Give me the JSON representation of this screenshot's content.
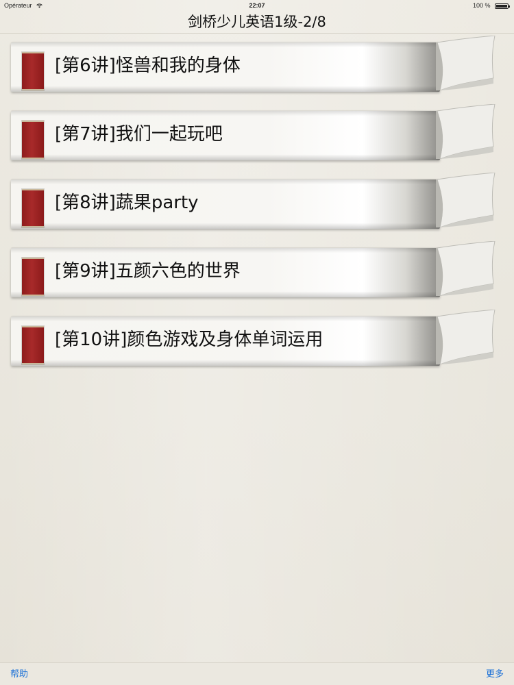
{
  "status_bar": {
    "carrier": "Opérateur",
    "time": "22:07",
    "battery": "100 %"
  },
  "nav": {
    "title": "剑桥少儿英语1级-2/8"
  },
  "lessons": [
    {
      "label": "[第6讲]怪兽和我的身体"
    },
    {
      "label": "[第7讲]我们一起玩吧"
    },
    {
      "label": "[第8讲]蔬果party"
    },
    {
      "label": "[第9讲]五颜六色的世界"
    },
    {
      "label": "[第10讲]颜色游戏及身体单词运用"
    }
  ],
  "bottom_bar": {
    "help_label": "帮助",
    "more_label": "更多"
  },
  "colors": {
    "bookmark": "#a82a2a",
    "link": "#1a6fd6",
    "background": "#ece9e1"
  },
  "icons": [
    "wifi-icon",
    "battery-icon",
    "bookmark-icon",
    "page-curl-icon"
  ]
}
